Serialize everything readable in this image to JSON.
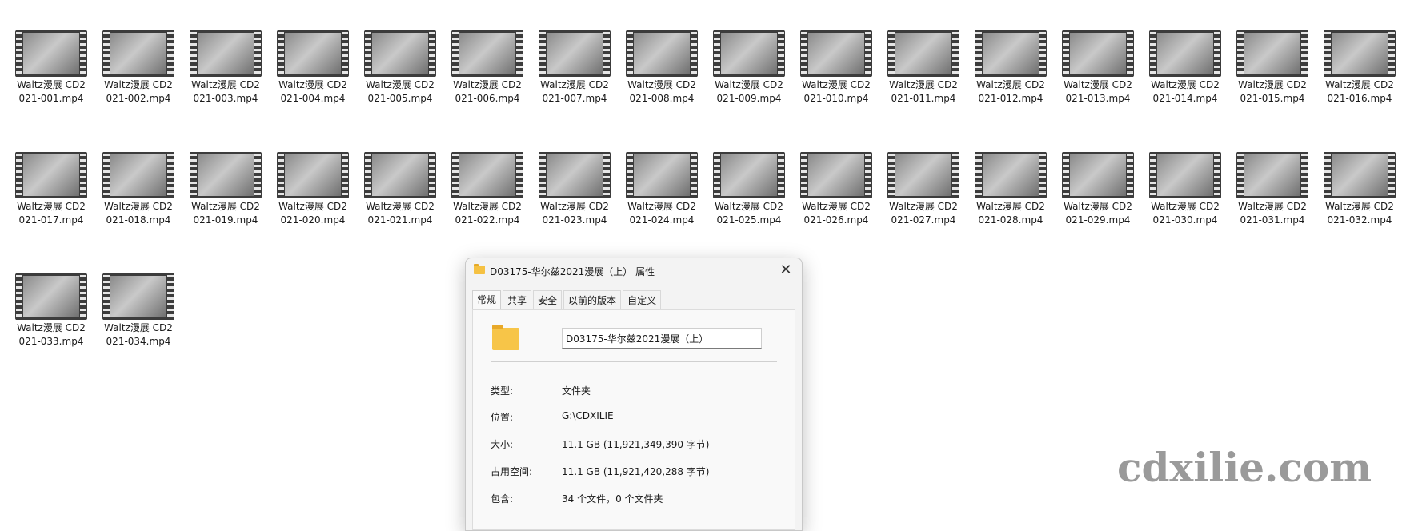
{
  "files": [
    {
      "name": "Waltz漫展 CD2021-001.mp4"
    },
    {
      "name": "Waltz漫展 CD2021-002.mp4"
    },
    {
      "name": "Waltz漫展 CD2021-003.mp4"
    },
    {
      "name": "Waltz漫展 CD2021-004.mp4"
    },
    {
      "name": "Waltz漫展 CD2021-005.mp4"
    },
    {
      "name": "Waltz漫展 CD2021-006.mp4"
    },
    {
      "name": "Waltz漫展 CD2021-007.mp4"
    },
    {
      "name": "Waltz漫展 CD2021-008.mp4"
    },
    {
      "name": "Waltz漫展 CD2021-009.mp4"
    },
    {
      "name": "Waltz漫展 CD2021-010.mp4"
    },
    {
      "name": "Waltz漫展 CD2021-011.mp4"
    },
    {
      "name": "Waltz漫展 CD2021-012.mp4"
    },
    {
      "name": "Waltz漫展 CD2021-013.mp4"
    },
    {
      "name": "Waltz漫展 CD2021-014.mp4"
    },
    {
      "name": "Waltz漫展 CD2021-015.mp4"
    },
    {
      "name": "Waltz漫展 CD2021-016.mp4"
    },
    {
      "name": "Waltz漫展 CD2021-017.mp4"
    },
    {
      "name": "Waltz漫展 CD2021-018.mp4"
    },
    {
      "name": "Waltz漫展 CD2021-019.mp4"
    },
    {
      "name": "Waltz漫展 CD2021-020.mp4"
    },
    {
      "name": "Waltz漫展 CD2021-021.mp4"
    },
    {
      "name": "Waltz漫展 CD2021-022.mp4"
    },
    {
      "name": "Waltz漫展 CD2021-023.mp4"
    },
    {
      "name": "Waltz漫展 CD2021-024.mp4"
    },
    {
      "name": "Waltz漫展 CD2021-025.mp4"
    },
    {
      "name": "Waltz漫展 CD2021-026.mp4"
    },
    {
      "name": "Waltz漫展 CD2021-027.mp4"
    },
    {
      "name": "Waltz漫展 CD2021-028.mp4"
    },
    {
      "name": "Waltz漫展 CD2021-029.mp4"
    },
    {
      "name": "Waltz漫展 CD2021-030.mp4"
    },
    {
      "name": "Waltz漫展 CD2021-031.mp4"
    },
    {
      "name": "Waltz漫展 CD2021-032.mp4"
    },
    {
      "name": "Waltz漫展 CD2021-033.mp4"
    },
    {
      "name": "Waltz漫展 CD2021-034.mp4"
    }
  ],
  "file_icon": "video-thumbnail-icon",
  "dialog": {
    "title": "D03175-华尔兹2021漫展（上） 属性",
    "close_icon": "close-icon",
    "tabs": [
      {
        "label": "常规",
        "active": true
      },
      {
        "label": "共享"
      },
      {
        "label": "安全"
      },
      {
        "label": "以前的版本"
      },
      {
        "label": "自定义"
      }
    ],
    "folder_icon": "folder-icon",
    "name_value": "D03175-华尔兹2021漫展（上）",
    "properties": [
      {
        "label": "类型:",
        "value": "文件夹"
      },
      {
        "label": "位置:",
        "value": "G:\\CDXILIE"
      },
      {
        "label": "大小:",
        "value": "11.1 GB (11,921,349,390 字节)"
      },
      {
        "label": "占用空间:",
        "value": "11.1 GB (11,921,420,288 字节)"
      },
      {
        "label": "包含:",
        "value": "34 个文件，0 个文件夹"
      }
    ]
  },
  "watermark": "cdxilie.com",
  "colors": {
    "folder": "#f7c548",
    "watermark": "#9a9a9a"
  }
}
